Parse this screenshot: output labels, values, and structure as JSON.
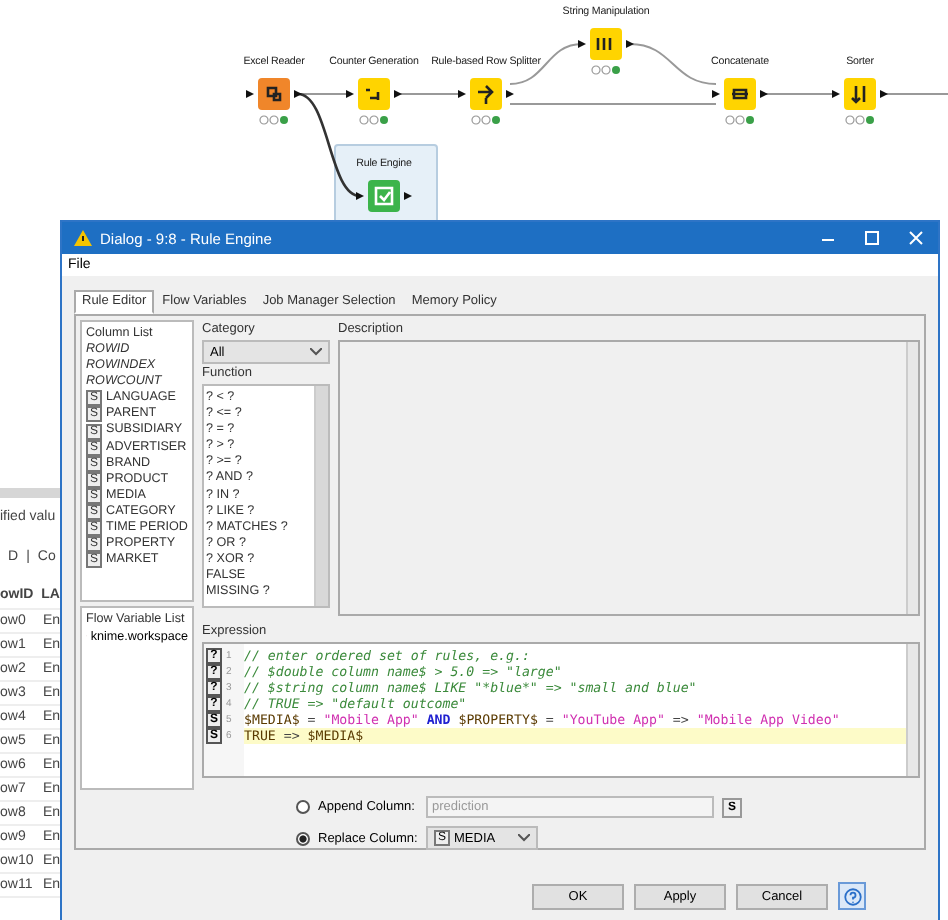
{
  "workflow": {
    "nodes": [
      {
        "label": "Excel Reader",
        "color": "#f0862a",
        "selected": false
      },
      {
        "label": "Counter Generation",
        "color": "#ffd400",
        "selected": false
      },
      {
        "label": "Rule-based Row Splitter",
        "color": "#ffd400",
        "selected": false
      },
      {
        "label": "String Manipulation",
        "color": "#ffd400",
        "selected": false
      },
      {
        "label": "Concatenate",
        "color": "#ffd400",
        "selected": false
      },
      {
        "label": "Sorter",
        "color": "#ffd400",
        "selected": false
      },
      {
        "label": "Rule Engine",
        "color": "#3cb44b",
        "selected": true
      }
    ]
  },
  "table_panel": {
    "message": "ified valu",
    "toolbar": [
      "D",
      "|",
      "Co"
    ],
    "columns": [
      "owID",
      "LA"
    ],
    "rows": [
      {
        "id": "ow0",
        "column_2": "En"
      },
      {
        "id": "ow1",
        "column_2": "En"
      },
      {
        "id": "ow2",
        "column_2": "En"
      },
      {
        "id": "ow3",
        "column_2": "En"
      },
      {
        "id": "ow4",
        "column_2": "En"
      },
      {
        "id": "ow5",
        "column_2": "En"
      },
      {
        "id": "ow6",
        "column_2": "En"
      },
      {
        "id": "ow7",
        "column_2": "En"
      },
      {
        "id": "ow8",
        "column_2": "En"
      },
      {
        "id": "ow9",
        "column_2": "En"
      },
      {
        "id": "ow10",
        "column_2": "En"
      },
      {
        "id": "ow11",
        "column_2": "En"
      }
    ]
  },
  "window": {
    "title": "Dialog - 9:8 - Rule Engine",
    "menu": [
      "File"
    ],
    "tabs": [
      {
        "label": "Rule Editor",
        "selected": true
      },
      {
        "label": "Flow Variables",
        "selected": false
      },
      {
        "label": "Job Manager Selection",
        "selected": false
      },
      {
        "label": "Memory Policy",
        "selected": false
      }
    ],
    "column_list": {
      "title": "Column List",
      "items": [
        {
          "kind": "special",
          "name": "ROWID"
        },
        {
          "kind": "special",
          "name": "ROWINDEX"
        },
        {
          "kind": "special",
          "name": "ROWCOUNT"
        },
        {
          "kind": "string",
          "type": "S",
          "name": "LANGUAGE"
        },
        {
          "kind": "string",
          "type": "S",
          "name": "PARENT"
        },
        {
          "kind": "string",
          "type": "S",
          "name": "SUBSIDIARY"
        },
        {
          "kind": "string",
          "type": "S",
          "name": "ADVERTISER"
        },
        {
          "kind": "string",
          "type": "S",
          "name": "BRAND"
        },
        {
          "kind": "string",
          "type": "S",
          "name": "PRODUCT"
        },
        {
          "kind": "string",
          "type": "S",
          "name": "MEDIA"
        },
        {
          "kind": "string",
          "type": "S",
          "name": "CATEGORY"
        },
        {
          "kind": "string",
          "type": "S",
          "name": "TIME PERIOD"
        },
        {
          "kind": "string",
          "type": "S",
          "name": "PROPERTY"
        },
        {
          "kind": "string",
          "type": "S",
          "name": "MARKET"
        }
      ]
    },
    "flow_variable_list": {
      "title": "Flow Variable List",
      "items": [
        "knime.workspace"
      ]
    },
    "category": {
      "label": "Category",
      "value": "All"
    },
    "function": {
      "label": "Function",
      "items": [
        "? < ?",
        "? <= ?",
        "? = ?",
        "? > ?",
        "? >= ?",
        "? AND ?",
        "? IN ?",
        "? LIKE ?",
        "? MATCHES ?",
        "? OR ?",
        "? XOR ?",
        "FALSE",
        "MISSING ?"
      ]
    },
    "description": {
      "label": "Description"
    },
    "expression": {
      "label": "Expression",
      "lines": [
        {
          "marker": "?",
          "number": "1",
          "current": false,
          "segments": [
            {
              "kind": "comment",
              "text": "// enter ordered set of rules, e.g.:"
            }
          ]
        },
        {
          "marker": "?",
          "number": "2",
          "current": false,
          "segments": [
            {
              "kind": "comment",
              "text": "// $double column name$ > 5.0 => \"large\""
            }
          ]
        },
        {
          "marker": "?",
          "number": "3",
          "current": false,
          "segments": [
            {
              "kind": "comment",
              "text": "// $string column name$ LIKE \"*blue*\" => \"small and blue\""
            }
          ]
        },
        {
          "marker": "?",
          "number": "4",
          "current": false,
          "segments": [
            {
              "kind": "comment",
              "text": "// TRUE => \"default outcome\""
            }
          ]
        },
        {
          "marker": "S",
          "number": "5",
          "current": false,
          "segments": [
            {
              "kind": "column",
              "text": "$MEDIA$"
            },
            {
              "kind": "operator",
              "text": " = "
            },
            {
              "kind": "string",
              "text": "\"Mobile App\""
            },
            {
              "kind": "keyword",
              "text": " AND "
            },
            {
              "kind": "column",
              "text": "$PROPERTY$"
            },
            {
              "kind": "operator",
              "text": " = "
            },
            {
              "kind": "string",
              "text": "\"YouTube App\""
            },
            {
              "kind": "operator",
              "text": " => "
            },
            {
              "kind": "string",
              "text": "\"Mobile App Video\""
            }
          ]
        },
        {
          "marker": "S",
          "number": "6",
          "current": true,
          "segments": [
            {
              "kind": "column",
              "text": "TRUE"
            },
            {
              "kind": "operator",
              "text": " => "
            },
            {
              "kind": "column",
              "text": "$MEDIA$"
            }
          ]
        }
      ]
    },
    "append_column": {
      "label": "Append Column:",
      "selected": false,
      "disabled": true,
      "value": "prediction",
      "type": "S"
    },
    "replace_column": {
      "label": "Replace Column:",
      "selected": true,
      "type": "S",
      "value": "MEDIA"
    },
    "buttons": [
      "OK",
      "Apply",
      "Cancel"
    ]
  }
}
